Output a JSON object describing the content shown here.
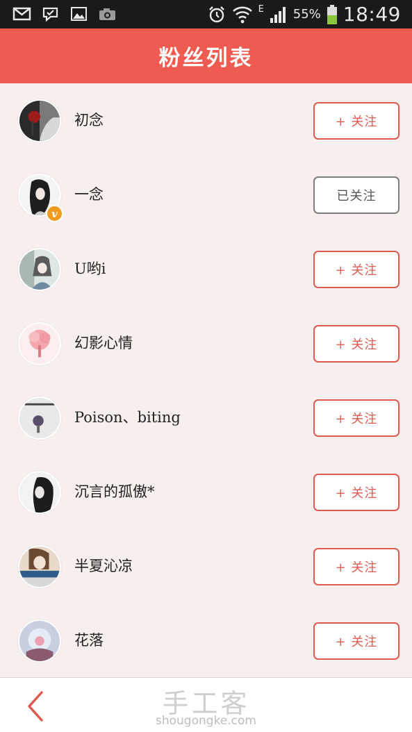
{
  "status_bar": {
    "network_label": "E",
    "battery_percent": "55%",
    "time": "18:49",
    "left_icons": [
      "mail-icon",
      "check-chat-icon",
      "gallery-icon",
      "camera-icon"
    ],
    "right_icons": [
      "alarm-icon",
      "wifi-icon",
      "signal-icon",
      "battery-icon"
    ]
  },
  "header": {
    "title": "粉丝列表",
    "color": "#ef5b51"
  },
  "fans": [
    {
      "name": "初念",
      "button": "+ 关注",
      "following": false,
      "verified": false,
      "avatar_icon": "avatar-rose-icon"
    },
    {
      "name": "一念",
      "button": "已关注",
      "following": true,
      "verified": true,
      "badge": "v",
      "avatar_icon": "avatar-girl-sketch-icon"
    },
    {
      "name": "U哟i",
      "button": "+ 关注",
      "following": false,
      "verified": false,
      "avatar_icon": "avatar-anime-girl-icon"
    },
    {
      "name": "幻影心情",
      "button": "+ 关注",
      "following": false,
      "verified": false,
      "avatar_icon": "avatar-pink-tree-icon"
    },
    {
      "name": "Poison、biting",
      "button": "+ 关注",
      "following": false,
      "verified": false,
      "avatar_icon": "avatar-text-photo-icon"
    },
    {
      "name": "沉言的孤傲*",
      "button": "+ 关注",
      "following": false,
      "verified": false,
      "avatar_icon": "avatar-bw-girl-icon"
    },
    {
      "name": "半夏沁凉",
      "button": "+ 关注",
      "following": false,
      "verified": false,
      "avatar_icon": "avatar-world-icon"
    },
    {
      "name": "花落",
      "button": "+ 关注",
      "following": false,
      "verified": false,
      "avatar_icon": "avatar-snow-globe-icon"
    }
  ],
  "bottom_bar": {
    "back_icon": "chevron-left-icon",
    "watermark_cn": "手工客",
    "watermark_en": "shougongke.com"
  },
  "colors": {
    "accent": "#e05a4f",
    "following_border": "#7d7d7d",
    "background": "#f7eeee",
    "badge": "#f29a1e"
  }
}
